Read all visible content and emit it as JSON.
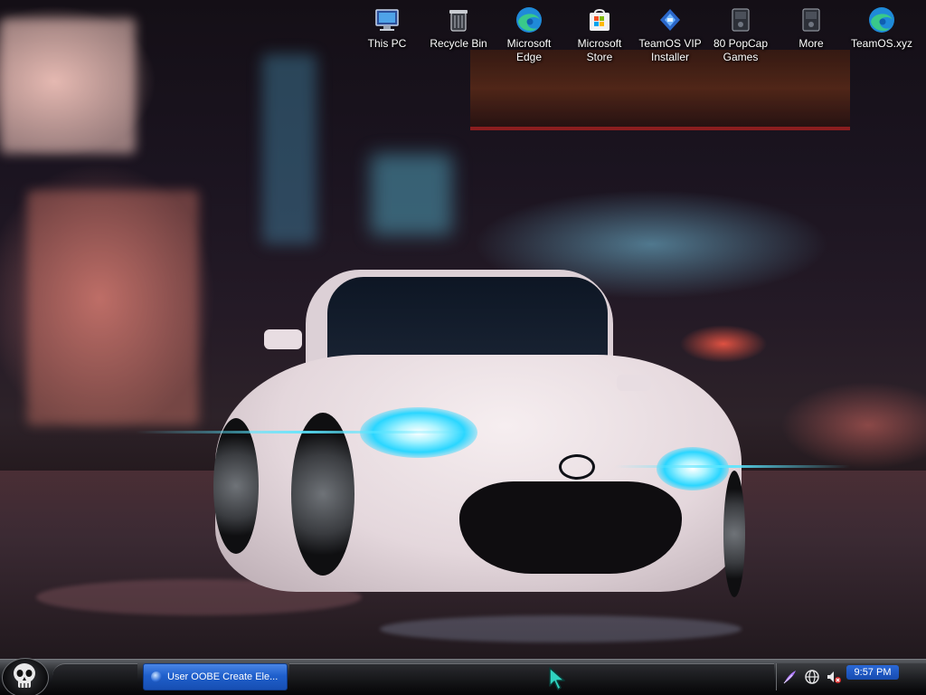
{
  "desktop": {
    "icons": [
      {
        "label": "This PC",
        "icon": "this-pc-icon"
      },
      {
        "label": "Recycle Bin",
        "icon": "recycle-bin-icon"
      },
      {
        "label": "Microsoft Edge",
        "icon": "edge-icon"
      },
      {
        "label": "Microsoft Store",
        "icon": "store-icon"
      },
      {
        "label": "TeamOS VIP Installer",
        "icon": "installer-icon"
      },
      {
        "label": "80 PopCap Games",
        "icon": "popcap-icon"
      },
      {
        "label": "More",
        "icon": "more-icon"
      },
      {
        "label": "TeamOS.xyz",
        "icon": "edge-icon"
      }
    ]
  },
  "taskbar": {
    "task_button_label": "User OOBE Create Ele...",
    "clock": "9:57 PM",
    "tray_icons": [
      "feather-icon",
      "network-globe-icon",
      "volume-muted-icon"
    ]
  },
  "colors": {
    "taskbar_active": "#1f5fcc",
    "clock_bg": "#2a68d6",
    "headlight": "#2ad6ff"
  }
}
